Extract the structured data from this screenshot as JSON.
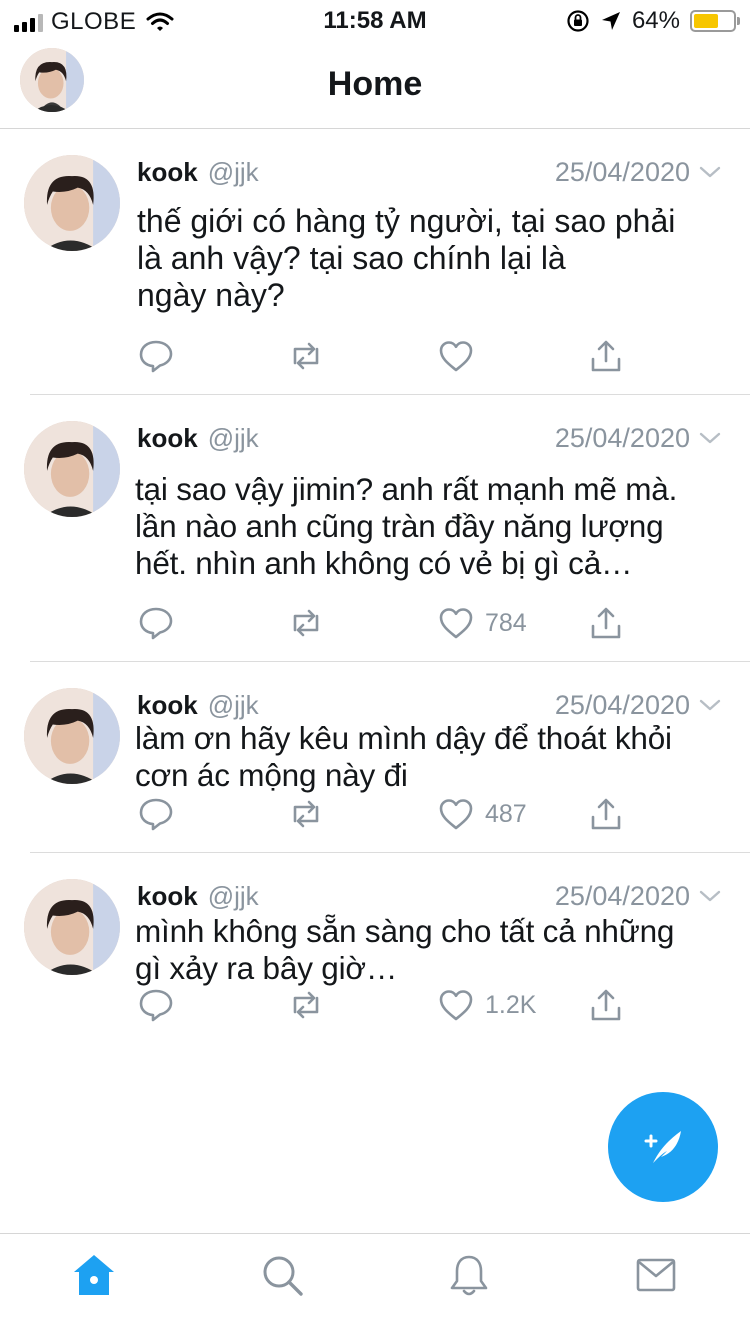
{
  "status_bar": {
    "carrier": "GLOBE",
    "time": "11:58 AM",
    "battery_percent": "64%",
    "battery_level": 0.64,
    "battery_color": "#f7c600",
    "icons": [
      "signal-icon",
      "wifi-icon",
      "orientation-lock-icon",
      "location-arrow-icon",
      "battery-icon"
    ]
  },
  "header": {
    "title": "Home",
    "avatar_icon": "profile-avatar"
  },
  "tweets": [
    {
      "name": "kook",
      "handle": "@jjk",
      "date": "25/04/2020",
      "text_lines": [
        "thế giới có hàng tỷ người, tại sao phải",
        "là anh vậy? tại sao chính lại là",
        "ngày này?"
      ],
      "likes": ""
    },
    {
      "name": "kook",
      "handle": "@jjk",
      "date": "25/04/2020",
      "text_lines": [
        "tại sao vậy jimin? anh rất mạnh mẽ mà.",
        "lần nào anh cũng tràn đầy năng lượng",
        "hết. nhìn anh không có vẻ bị gì cả…"
      ],
      "likes": "784"
    },
    {
      "name": "kook",
      "handle": "@jjk",
      "date": "25/04/2020",
      "text_lines": [
        "làm ơn hãy kêu mình dậy để thoát khỏi",
        "cơn ác mộng này đi"
      ],
      "likes": "487"
    },
    {
      "name": "kook",
      "handle": "@jjk",
      "date": "25/04/2020",
      "text_lines": [
        "mình không sẵn sàng cho tất cả những",
        "gì xảy ra bây giờ…"
      ],
      "likes": "1.2K"
    }
  ],
  "action_icons": [
    "reply-icon",
    "retweet-icon",
    "like-icon",
    "share-icon"
  ],
  "compose": {
    "icon": "compose-feather-icon",
    "color": "#1da1f2"
  },
  "tab_bar": {
    "tabs": [
      {
        "name": "home",
        "icon": "home-icon",
        "active": true
      },
      {
        "name": "search",
        "icon": "search-icon",
        "active": false
      },
      {
        "name": "notifications",
        "icon": "bell-icon",
        "active": false
      },
      {
        "name": "messages",
        "icon": "mail-icon",
        "active": false
      }
    ],
    "active_color": "#1da1f2",
    "inactive_color": "#8a949e"
  }
}
